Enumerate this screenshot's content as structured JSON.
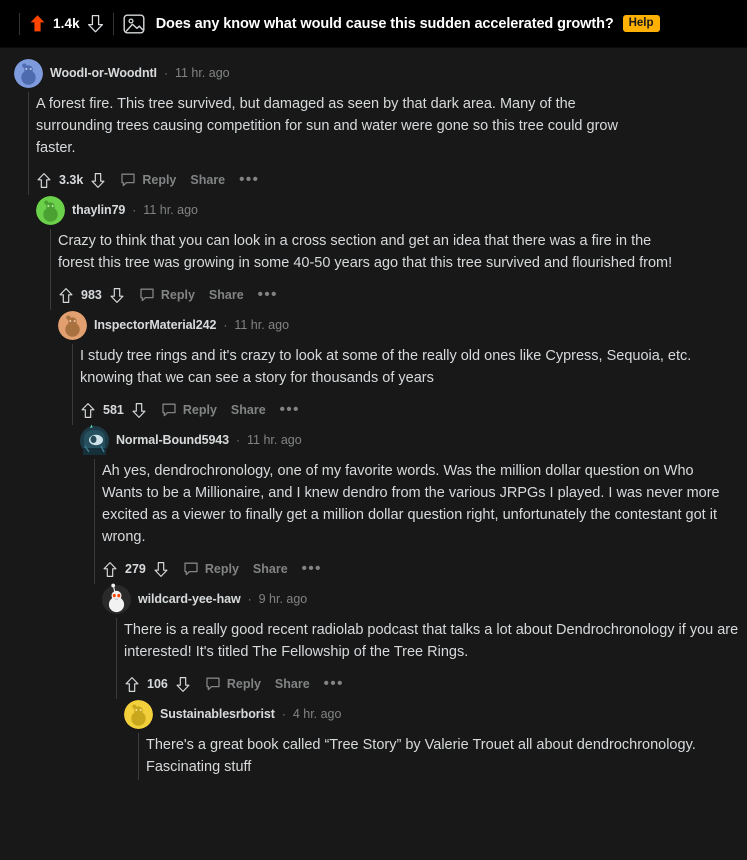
{
  "header": {
    "vote_count": "1.4k",
    "upvote_icon": "arrow-up-filled-icon",
    "downvote_icon": "arrow-down-outline-icon",
    "thumbnail_icon": "image-thumbnail-icon",
    "title": "Does any know what would cause this sudden accelerated growth?",
    "flair": "Help",
    "accent_upvote_color": "#ff4500",
    "flair_bg_color": "#ffb000"
  },
  "actions": {
    "reply_label": "Reply",
    "share_label": "Share",
    "overflow_label": "•••",
    "upvote_icon": "arrow-up-outline-icon",
    "downvote_icon": "arrow-down-outline-icon",
    "reply_icon": "speech-bubble-icon"
  },
  "separator": "·",
  "comments": [
    {
      "author": "WoodI-or-WoodntI",
      "time": "11 hr. ago",
      "body": "A forest fire. This tree survived, but damaged as seen by that dark area. Many of the surrounding trees causing competition for sun and water were gone so this tree could grow faster.",
      "score": "3.3k",
      "avatar": {
        "name": "snoo-avatar-blue",
        "bg": "#7e9bdd",
        "body": "#4f6bb0"
      }
    },
    {
      "author": "thaylin79",
      "time": "11 hr. ago",
      "body": "Crazy to think that you can look in a cross section and get an idea that there was a fire in the forest this tree was growing in some 40-50 years ago that this tree survived and flourished from!",
      "score": "983",
      "avatar": {
        "name": "snoo-avatar-green",
        "bg": "#6cd14a",
        "body": "#4ba233"
      }
    },
    {
      "author": "InspectorMaterial242",
      "time": "11 hr. ago",
      "body": "I study tree rings and it's crazy to look at some of the really old ones like Cypress, Sequoia, etc. knowing that we can see a story for thousands of years",
      "score": "581",
      "avatar": {
        "name": "snoo-avatar-orange",
        "bg": "#e2a070",
        "body": "#a9713f"
      }
    },
    {
      "author": "Normal-Bound5943",
      "time": "11 hr. ago",
      "body": "Ah yes, dendrochronology, one of my favorite words. Was the million dollar question on Who Wants to be a Millionaire, and I knew dendro from the various JRPGs I played. I was never more excited as a viewer to finally get a million dollar question right, unfortunately the contestant got it wrong.",
      "score": "279",
      "avatar": {
        "name": "custom-avatar-teal-hood",
        "bg": "#1d3a47",
        "body": "#9fc6d4"
      }
    },
    {
      "author": "wildcard-yee-haw",
      "time": "9 hr. ago",
      "body": "There is a really good recent radiolab podcast that talks a lot about Dendrochronology if you are interested! It's titled The Fellowship of the Tree Rings.",
      "score": "106",
      "avatar": {
        "name": "snoo-avatar-white",
        "bg": "#2a2a2b",
        "body": "#f2f2f2"
      }
    },
    {
      "author": "Sustainablesrborist",
      "time": "4 hr. ago",
      "body": "There's a great book called “Tree Story” by Valerie Trouet all about dendrochronology. Fascinating stuff",
      "score": "",
      "avatar": {
        "name": "snoo-avatar-yellow",
        "bg": "#f2d03b",
        "body": "#c9a81d"
      }
    }
  ]
}
